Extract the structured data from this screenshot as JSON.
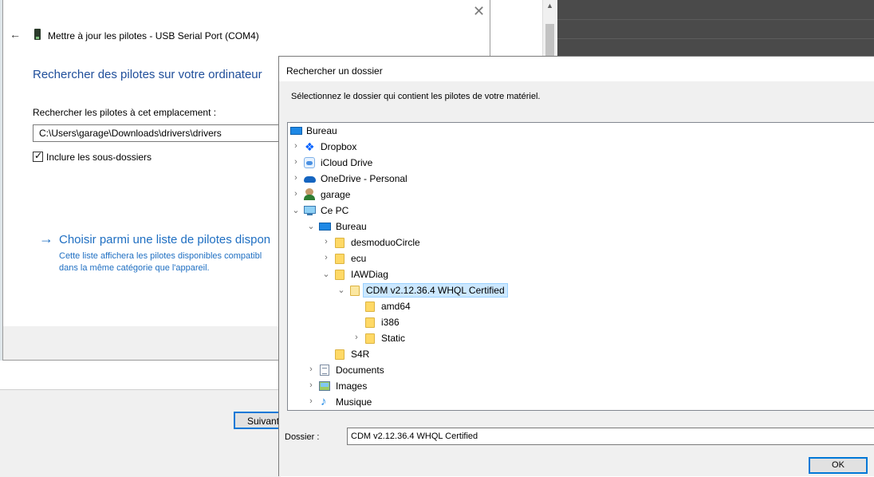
{
  "wizard": {
    "title": "Mettre à jour les pilotes - USB Serial Port (COM4)",
    "heading": "Rechercher des pilotes sur votre ordinateur",
    "location_label": "Rechercher les pilotes à cet emplacement :",
    "path_value": "C:\\Users\\garage\\Downloads\\drivers\\drivers",
    "include_subfolders_label": "Inclure les sous-dossiers",
    "include_subfolders_checked": true,
    "choose_link": "Choisir parmi une liste de pilotes dispon",
    "choose_desc_line1": "Cette liste affichera les pilotes disponibles compatibl",
    "choose_desc_line2": "dans la même catégorie que l'appareil.",
    "next_button": "Suivant"
  },
  "dialog": {
    "title": "Rechercher un dossier",
    "instruction": "Sélectionnez le dossier qui contient les pilotes de votre matériel.",
    "folder_label": "Dossier :",
    "folder_value": "CDM v2.12.36.4 WHQL Certified",
    "ok_button": "OK",
    "tree": [
      {
        "label": "Bureau",
        "icon": "desktop-icon",
        "level": 0,
        "chevron": ""
      },
      {
        "label": "Dropbox",
        "icon": "dropbox-icon",
        "level": 1,
        "chevron": "collapsed"
      },
      {
        "label": "iCloud Drive",
        "icon": "icloud-icon",
        "level": 1,
        "chevron": "collapsed"
      },
      {
        "label": "OneDrive - Personal",
        "icon": "onedrive-icon",
        "level": 1,
        "chevron": "collapsed"
      },
      {
        "label": "garage",
        "icon": "user-icon",
        "level": 1,
        "chevron": "collapsed"
      },
      {
        "label": "Ce PC",
        "icon": "pc-icon",
        "level": 1,
        "chevron": "expanded"
      },
      {
        "label": "Bureau",
        "icon": "desktop-icon",
        "level": 2,
        "chevron": "expanded"
      },
      {
        "label": "desmoduoCircle",
        "icon": "folder-icon",
        "level": 3,
        "chevron": "collapsed"
      },
      {
        "label": "ecu",
        "icon": "folder-icon",
        "level": 3,
        "chevron": "collapsed"
      },
      {
        "label": "IAWDiag",
        "icon": "folder-icon",
        "level": 3,
        "chevron": "expanded"
      },
      {
        "label": "CDM v2.12.36.4 WHQL Certified",
        "icon": "folder-open-icon",
        "level": 4,
        "chevron": "expanded",
        "selected": true
      },
      {
        "label": "amd64",
        "icon": "folder-icon",
        "level": 5,
        "chevron": ""
      },
      {
        "label": "i386",
        "icon": "folder-icon",
        "level": 5,
        "chevron": ""
      },
      {
        "label": "Static",
        "icon": "folder-icon",
        "level": 5,
        "chevron": "collapsed"
      },
      {
        "label": "S4R",
        "icon": "folder-icon",
        "level": 3,
        "chevron": ""
      },
      {
        "label": "Documents",
        "icon": "documents-icon",
        "level": 2,
        "chevron": "collapsed"
      },
      {
        "label": "Images",
        "icon": "images-icon",
        "level": 2,
        "chevron": "collapsed"
      },
      {
        "label": "Musique",
        "icon": "music-icon",
        "level": 2,
        "chevron": "collapsed"
      }
    ]
  },
  "icons": {
    "back": "back-arrow-icon",
    "close": "close-icon",
    "link_arrow": "right-arrow-icon"
  }
}
